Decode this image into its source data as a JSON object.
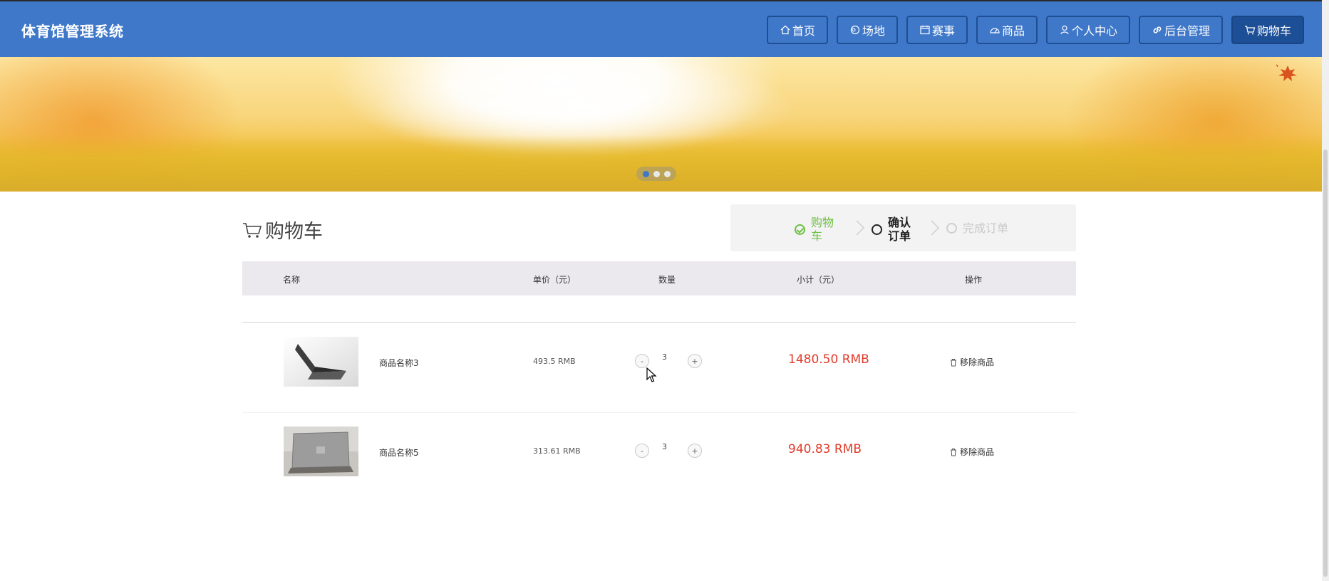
{
  "brand": "体育馆管理系统",
  "nav": [
    {
      "label": "首页",
      "icon": "home-icon"
    },
    {
      "label": "场地",
      "icon": "venue-icon"
    },
    {
      "label": "赛事",
      "icon": "calendar-icon"
    },
    {
      "label": "商品",
      "icon": "product-icon"
    },
    {
      "label": "个人中心",
      "icon": "user-icon"
    },
    {
      "label": "后台管理",
      "icon": "link-icon"
    },
    {
      "label": "购物车",
      "icon": "cart-icon",
      "active": true
    }
  ],
  "banner": {
    "slides": 3,
    "active_slide": 0
  },
  "cart": {
    "title": "购物车",
    "steps": [
      {
        "label": "购物车",
        "state": "done"
      },
      {
        "label": "确认订单",
        "state": "current"
      },
      {
        "label": "完成订单",
        "state": "pending"
      }
    ],
    "columns": {
      "name": "名称",
      "price": "单价（元）",
      "qty": "数量",
      "subtotal": "小计（元）",
      "action": "操作"
    },
    "items": [
      {
        "name": "商品名称3",
        "price": "493.5 RMB",
        "qty": "3",
        "subtotal": "1480.50 RMB",
        "remove": "移除商品",
        "minus": "-",
        "plus": "+"
      },
      {
        "name": "商品名称5",
        "price": "313.61 RMB",
        "qty": "3",
        "subtotal": "940.83 RMB",
        "remove": "移除商品",
        "minus": "-",
        "plus": "+"
      }
    ]
  },
  "colors": {
    "nav_bg": "#3f78c9",
    "nav_active": "#1d4f97",
    "subtotal": "#e23b2b",
    "step_done": "#6cbf45"
  }
}
